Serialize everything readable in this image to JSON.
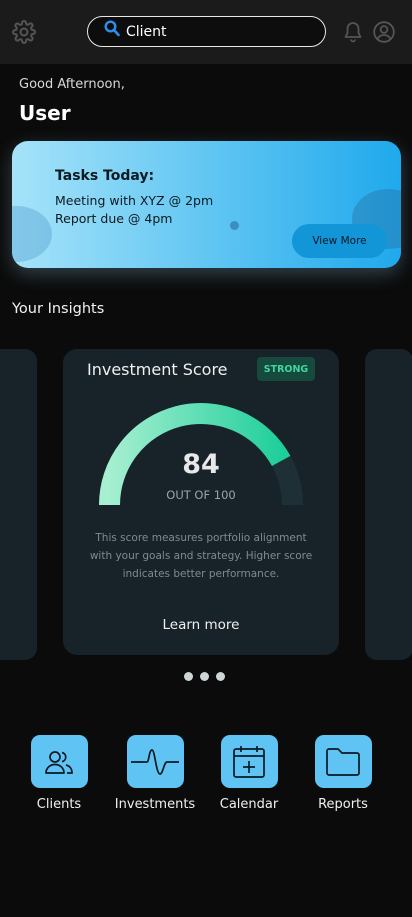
{
  "header": {
    "search": {
      "value": "Client"
    },
    "icons": [
      "gear-icon",
      "search-icon",
      "bell-icon",
      "user-icon"
    ]
  },
  "greeting": {
    "text": "Good Afternoon,",
    "name": "User"
  },
  "tasks": {
    "title": "Tasks Today:",
    "items": [
      "Meeting with XYZ  @ 2pm",
      "Report due @ 4pm"
    ],
    "button": "View More"
  },
  "insights": {
    "heading": "Your Insights",
    "card": {
      "title": "Investment Score",
      "badge": "STRONG",
      "score": "84",
      "score_value": 84,
      "out_of": "OUT OF 100",
      "description": "This score measures portfolio alignment with your goals and strategy. Higher score indicates better performance.",
      "link": "Learn more"
    },
    "pager": {
      "count": 3
    }
  },
  "nav": [
    {
      "label": "Clients",
      "icon": "users-icon"
    },
    {
      "label": "Investments",
      "icon": "pulse-icon"
    },
    {
      "label": "Calendar",
      "icon": "calendar-icon"
    },
    {
      "label": "Reports",
      "icon": "folder-icon"
    }
  ],
  "colors": {
    "accent": "#5fc3f3",
    "gauge_start": "#a6efd1",
    "gauge_end": "#1fcf9b",
    "badge_text": "#3fd6a0"
  }
}
